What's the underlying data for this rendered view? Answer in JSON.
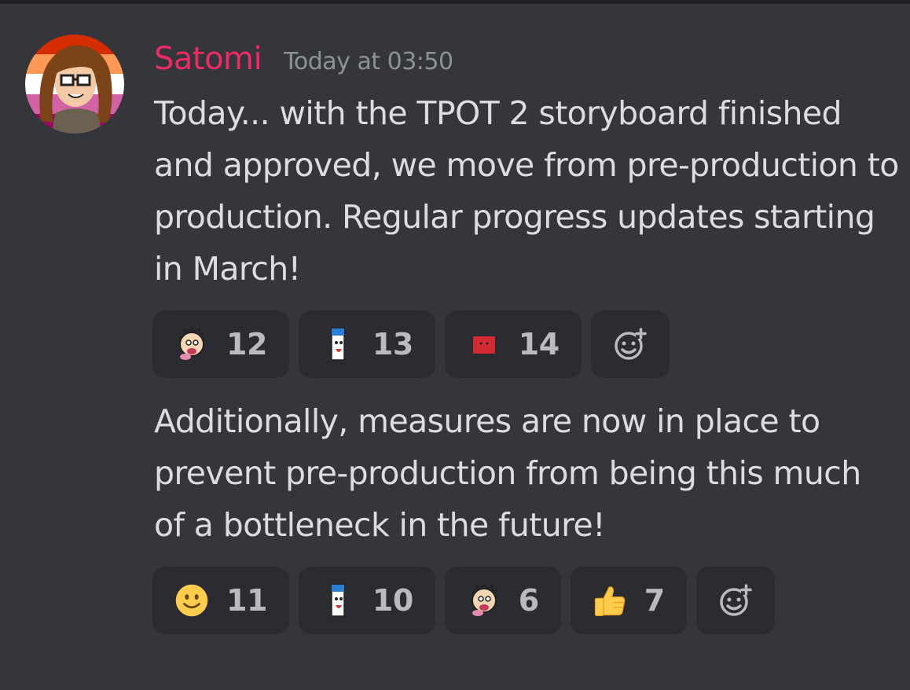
{
  "message": {
    "author": "Satomi",
    "author_color": "#ee2a65",
    "timestamp": "Today at 03:50",
    "avatar": "avatar-pride-flag-character",
    "paragraph_1": "Today... with the TPOT 2 storyboard finished and approved, we move from pre-production to production. Regular progress updates starting in March!",
    "paragraph_2": "Additionally, measures are now in place to prevent pre-production from being this much of a bottleneck in the future!"
  },
  "reactions_1": [
    {
      "emoji": "cartoon-face-emoji",
      "count": "12"
    },
    {
      "emoji": "blue-pen-character-emoji",
      "count": "13"
    },
    {
      "emoji": "red-block-character-emoji",
      "count": "14"
    }
  ],
  "reactions_2": [
    {
      "emoji": "slightly-smiling-face-emoji",
      "count": "11"
    },
    {
      "emoji": "blue-pen-character-emoji",
      "count": "10"
    },
    {
      "emoji": "cartoon-face-emoji",
      "count": "6"
    },
    {
      "emoji": "thumbs-up-emoji",
      "count": "7"
    }
  ],
  "add_reaction_icon": "add-reaction-icon"
}
